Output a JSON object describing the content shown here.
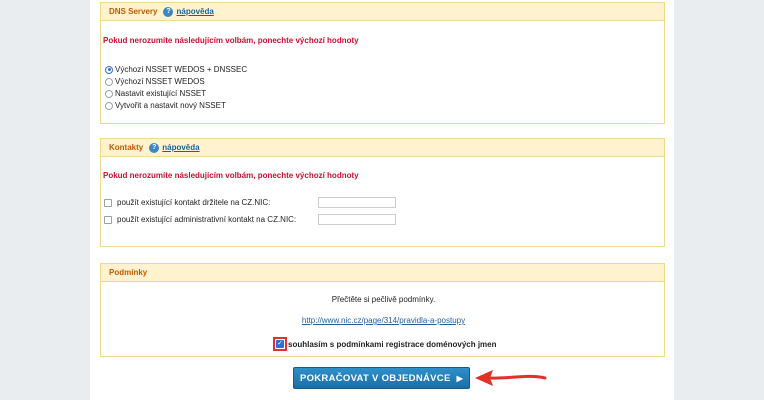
{
  "dns": {
    "title": "DNS Servery",
    "help_icon": "?",
    "help_label": "nápověda",
    "warning": "Pokud nerozumíte následujícím volbám, ponechte výchozí hodnoty",
    "options": [
      {
        "label": "Výchozí NSSET WEDOS + DNSSEC",
        "selected": true
      },
      {
        "label": "Výchozí NSSET WEDOS",
        "selected": false
      },
      {
        "label": "Nastavit existující NSSET",
        "selected": false
      },
      {
        "label": "Vytvořit a nastavit nový NSSET",
        "selected": false
      }
    ]
  },
  "contacts": {
    "title": "Kontakty",
    "help_icon": "?",
    "help_label": "nápověda",
    "warning": "Pokud nerozumíte následujícím volbám, ponechte výchozí hodnoty",
    "holder_label": "použít existující kontakt držitele na CZ.NIC:",
    "holder_value": "",
    "admin_label": "použít existující administrativní kontakt na CZ.NIC:",
    "admin_value": ""
  },
  "terms": {
    "title": "Podmínky",
    "read_text": "Přečtěte si pečlivě podmínky.",
    "link": "http://www.nic.cz/page/314/pravidla-a-postupy",
    "agree_label": "souhlasím s podmínkami registrace doménových jmen",
    "agree_checked": true
  },
  "submit": {
    "label": "POKRAČOVAT V OBJEDNÁVCE",
    "arrow": "▶"
  },
  "colors": {
    "section_border": "#f3d98c",
    "section_header_bg": "#fff3cf",
    "title": "#c25a00",
    "warning": "#c8102e",
    "link": "#1f5f9e",
    "button": "#1f7dba",
    "highlight": "#e0312a"
  }
}
